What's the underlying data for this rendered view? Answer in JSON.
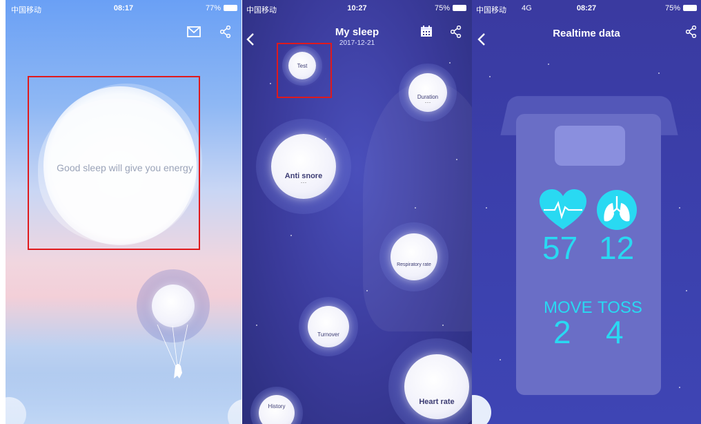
{
  "screen1": {
    "status": {
      "carrier": "中国移动",
      "time": "08:17",
      "battery": "77%"
    },
    "message": "Good sleep will give you energy",
    "icons": [
      "mail-icon",
      "share-icon"
    ]
  },
  "screen2": {
    "status": {
      "carrier": "中国移动",
      "time": "10:27",
      "battery": "75%"
    },
    "title": "My sleep",
    "date": "2017-12-21",
    "bubbles": {
      "test": "Test",
      "duration": "Duration",
      "duration_value": "···",
      "anti_snore": "Anti snore",
      "anti_snore_value": "···",
      "respiratory": "Respiratory rate",
      "turnover": "Turnover",
      "history": "History",
      "heart_rate": "Heart rate"
    }
  },
  "screen3": {
    "status": {
      "carrier": "中国移动",
      "network": "4G",
      "time": "08:27",
      "battery": "75%"
    },
    "title": "Realtime data",
    "heart_value": "57",
    "breath_value": "12",
    "move_label": "MOVE",
    "toss_label": "TOSS",
    "move_value": "2",
    "toss_value": "4"
  },
  "colors": {
    "accent": "#29d9f2",
    "highlight": "#e0191c"
  }
}
